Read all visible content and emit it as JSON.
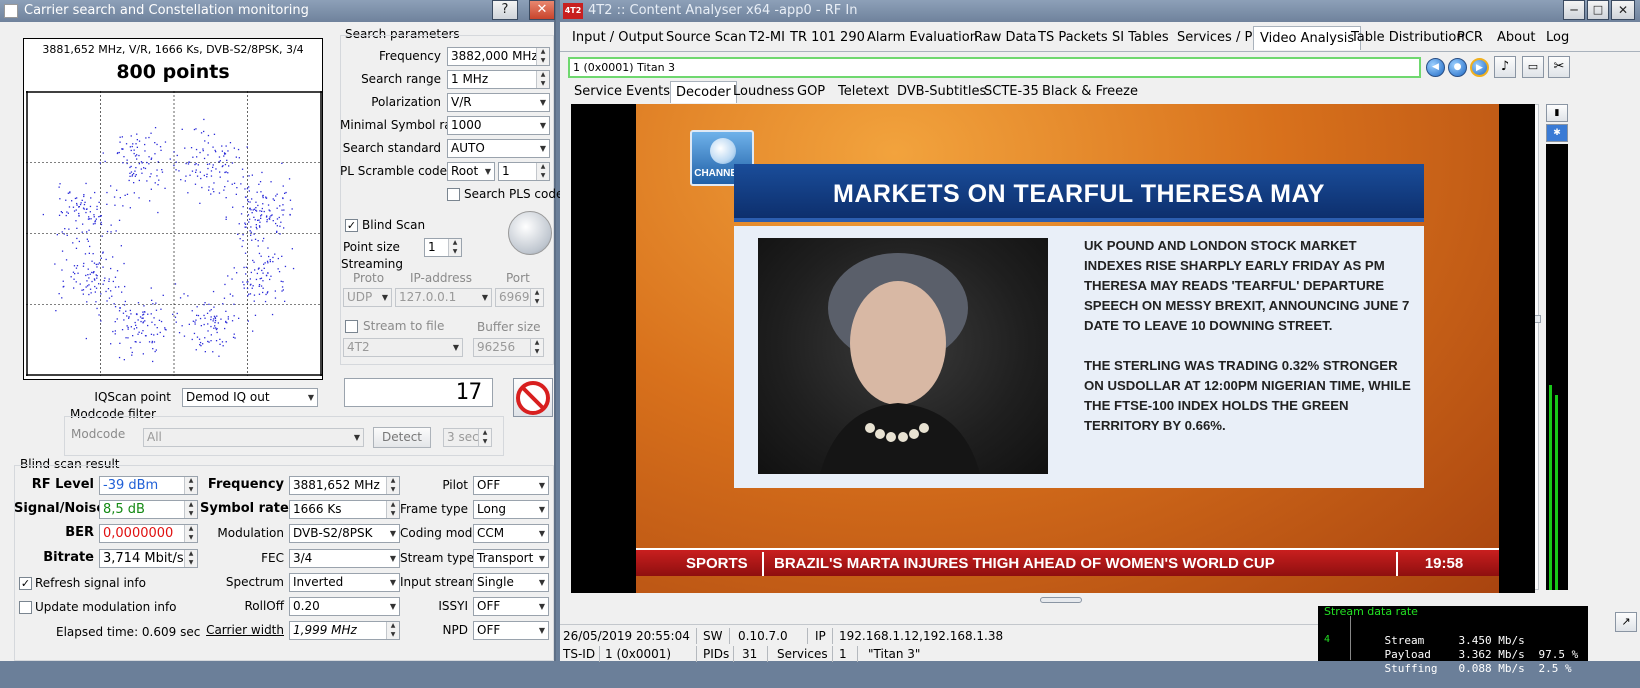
{
  "left_window": {
    "title": "Carrier search and Constellation monitoring",
    "help_btn": "?",
    "close_btn": "✕",
    "constellation": {
      "header": "3881,652 MHz, V/R, 1666 Ks, DVB-S2/8PSK, 3/4",
      "points_label": "800 points"
    },
    "search_params": {
      "title": "Search parameters",
      "frequency_label": "Frequency",
      "frequency_value": "3882,000 MHz",
      "range_label": "Search range",
      "range_value": "1 MHz",
      "polarization_label": "Polarization",
      "polarization_value": "V/R",
      "min_sr_label": "Minimal Symbol rate",
      "min_sr_value": "1000",
      "standard_label": "Search standard",
      "standard_value": "AUTO",
      "pls_label": "PL Scramble code",
      "pls_mode": "Root",
      "pls_value": "1",
      "search_pls_label": "Search PLS code"
    },
    "blind_scan_label": "Blind Scan",
    "blind_scan_check": "✓",
    "point_size_label": "Point size",
    "point_size_value": "1",
    "streaming": {
      "title": "Streaming",
      "proto_label": "Proto",
      "ip_label": "IP-address",
      "port_label": "Port",
      "proto_value": "UDP",
      "ip_value": "127.0.0.1",
      "port_value": "6969",
      "stream_to_file_label": "Stream to file",
      "buffer_label": "Buffer size",
      "file_value": "4T2",
      "buffer_value": "96256"
    },
    "counter_value": "17",
    "iqscan_label": "IQScan point",
    "iqscan_value": "Demod IQ out",
    "modcode_filter": {
      "title": "Modcode filter",
      "modcode_label": "Modcode",
      "modcode_value": "All",
      "detect_label": "Detect",
      "sec_value": "3 sec"
    },
    "result": {
      "title": "Blind scan result",
      "rf_label": "RF Level",
      "rf_value": "-39 dBm",
      "sn_label": "Signal/Noise",
      "sn_value": "8,5 dB",
      "ber_label": "BER",
      "ber_value": "0,0000000",
      "bitrate_label": "Bitrate",
      "bitrate_value": "3,714 Mbit/s",
      "freq_label": "Frequency",
      "freq_value": "3881,652 MHz",
      "sr_label": "Symbol rate",
      "sr_value": "1666 Ks",
      "mod_label": "Modulation",
      "mod_value": "DVB-S2/8PSK",
      "fec_label": "FEC",
      "fec_value": "3/4",
      "spectrum_label": "Spectrum",
      "spectrum_value": "Inverted",
      "rolloff_label": "RollOff",
      "rolloff_value": "0.20",
      "carrier_width_label": "Carrier width",
      "carrier_width_value": "1,999 MHz",
      "pilot_label": "Pilot",
      "pilot_value": "OFF",
      "frame_label": "Frame type",
      "frame_value": "Long",
      "coding_label": "Coding mode",
      "coding_value": "CCM",
      "stream_type_label": "Stream type",
      "stream_type_value": "Transport",
      "input_stream_label": "Input stream",
      "input_stream_value": "Single",
      "issyi_label": "ISSYI",
      "issyi_value": "OFF",
      "npd_label": "NPD",
      "npd_value": "OFF",
      "refresh_label": "Refresh signal info",
      "refresh_check": "✓",
      "update_mod_label": "Update modulation info",
      "elapsed": "Elapsed time: 0.609 sec"
    }
  },
  "right_window": {
    "title": "4T2 :: Content Analyser x64  -app0 - RF In",
    "app_icon": "4T2",
    "tabs": [
      "Input / Output",
      "Source Scan",
      "T2-MI",
      "TR 101 290",
      "Alarm Evaluation",
      "Raw Data",
      "TS Packets",
      "SI Tables",
      "Services / PIDs",
      "Video Analysis",
      "Table Distribution",
      "PCR",
      "About",
      "Log"
    ],
    "service_value": "1 (0x0001) Titan 3",
    "subtabs": [
      "Service",
      "Events",
      "Decoder",
      "Loudness",
      "GOP",
      "Teletext",
      "DVB-Subtitles",
      "SCTE-35",
      "Black & Freeze"
    ],
    "video": {
      "logo_text": "CHANNELS",
      "headline": "MARKETS ON TEARFUL THERESA MAY",
      "paragraph1": "UK POUND AND LONDON STOCK MARKET INDEXES RISE SHARPLY EARLY FRIDAY AS PM THERESA MAY READS 'TEARFUL' DEPARTURE SPEECH ON MESSY BREXIT, ANNOUNCING JUNE 7 DATE TO LEAVE 10 DOWNING STREET.",
      "paragraph2": "THE STERLING WAS TRADING 0.32% STRONGER ON USDOLLAR AT 12:00PM NIGERIAN TIME, WHILE THE FTSE-100 INDEX HOLDS THE GREEN TERRITORY BY 0.66%.",
      "ticker_section": "SPORTS",
      "ticker_text": "BRAZIL'S MARTA INJURES THIGH AHEAD OF WOMEN'S WORLD CUP",
      "ticker_time": "19:58"
    },
    "status": {
      "datetime": "26/05/2019 20:55:04",
      "sw_label": "SW",
      "sw_value": "0.10.7.0",
      "ip_label": "IP",
      "ip_value": "192.168.1.12,192.168.1.38",
      "tsid_label": "TS-ID",
      "tsid_value": "1 (0x0001)",
      "pids_label": "PIDs",
      "pids_value": "31",
      "services_label": "Services",
      "services_value": "1",
      "service_name": "\"Titan 3\""
    },
    "rate_panel": {
      "title": "Stream data rate",
      "scale_label": "4",
      "rows": [
        {
          "name": "Stream",
          "value": "3.450 Mb/s",
          "pct": ""
        },
        {
          "name": "Payload",
          "value": "3.362 Mb/s",
          "pct": "97.5 %"
        },
        {
          "name": "Stuffing",
          "value": "0.088 Mb/s",
          "pct": "2.5 %"
        }
      ]
    }
  },
  "colors": {
    "rf_value": "#1f5fd6",
    "sn_value": "#148a14",
    "ber_value": "#e01010",
    "constellation_points": "#2a2ad8",
    "headline_bar": "#0d2f6d",
    "ticker": "#c91f1f",
    "selected_tab_border": "#a9b2bc",
    "service_field_border": "#6fd86f"
  }
}
